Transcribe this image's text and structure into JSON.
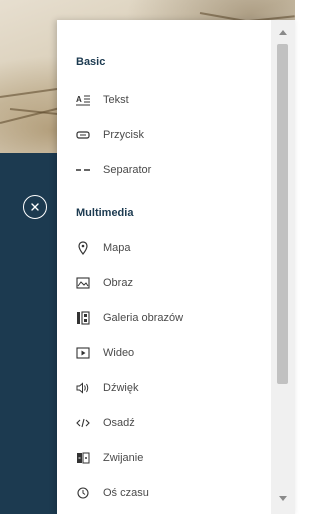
{
  "background": {
    "photo_colors": [
      "#e7dfd0",
      "#d9ceb8"
    ],
    "panel_color": "#1c3a50"
  },
  "close_button": {
    "icon": "close-icon"
  },
  "menu": {
    "sections": [
      {
        "heading": "Basic",
        "items": [
          {
            "label": "Tekst",
            "icon": "text-icon"
          },
          {
            "label": "Przycisk",
            "icon": "button-icon"
          },
          {
            "label": "Separator",
            "icon": "separator-icon"
          }
        ]
      },
      {
        "heading": "Multimedia",
        "items": [
          {
            "label": "Mapa",
            "icon": "map-pin-icon"
          },
          {
            "label": "Obraz",
            "icon": "image-icon"
          },
          {
            "label": "Galeria obrazów",
            "icon": "gallery-icon"
          },
          {
            "label": "Wideo",
            "icon": "video-icon"
          },
          {
            "label": "Dźwięk",
            "icon": "audio-icon"
          },
          {
            "label": "Osadź",
            "icon": "embed-icon"
          },
          {
            "label": "Zwijanie",
            "icon": "expand-icon"
          },
          {
            "label": "Oś czasu",
            "icon": "timeline-icon"
          }
        ]
      }
    ]
  },
  "scrollbar": {
    "up_icon": "scroll-up-arrow-icon",
    "down_icon": "scroll-down-arrow-icon",
    "position": 0
  }
}
